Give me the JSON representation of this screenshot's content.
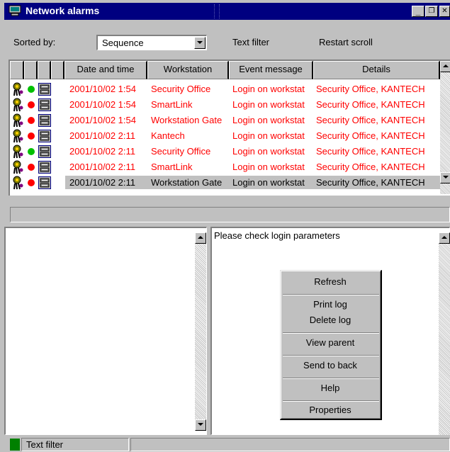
{
  "window": {
    "title": "Network alarms",
    "minimize_label": "_",
    "restore_label": "❐",
    "close_label": "✕"
  },
  "toolbar": {
    "sorted_by_label": "Sorted by:",
    "sort_value": "Sequence",
    "text_filter_label": "Text filter",
    "restart_scroll_label": "Restart scroll"
  },
  "table": {
    "columns": [
      "Date and time",
      "Workstation",
      "Event message",
      "Details"
    ],
    "rows": [
      {
        "date": "2001/10/02 1:54",
        "workstation": "Security Office",
        "event": "Login on workstat",
        "details": "Security Office, KANTECH",
        "status": "green"
      },
      {
        "date": "2001/10/02 1:54",
        "workstation": "SmartLink",
        "event": "Login on workstat",
        "details": "Security Office, KANTECH",
        "status": "red"
      },
      {
        "date": "2001/10/02 1:54",
        "workstation": "Workstation Gate",
        "event": "Login on workstat",
        "details": "Security Office, KANTECH",
        "status": "red"
      },
      {
        "date": "2001/10/02 2:11",
        "workstation": "Kantech",
        "event": "Login on workstat",
        "details": "Security Office, KANTECH",
        "status": "red"
      },
      {
        "date": "2001/10/02 2:11",
        "workstation": "Security Office",
        "event": "Login on workstat",
        "details": "Security Office, KANTECH",
        "status": "green"
      },
      {
        "date": "2001/10/02 2:11",
        "workstation": "SmartLink",
        "event": "Login on workstat",
        "details": "Security Office, KANTECH",
        "status": "red"
      },
      {
        "date": "2001/10/02 2:11",
        "workstation": "Workstation Gate",
        "event": "Login on workstat",
        "details": "Security Office, KANTECH",
        "status": "red",
        "selected": true
      }
    ]
  },
  "detail_pane": {
    "message": "Please check login parameters"
  },
  "context_menu": {
    "items": [
      "Refresh",
      "Print log",
      "Delete log",
      "View parent",
      "Send to back",
      "Help",
      "Properties"
    ]
  },
  "status_bar": {
    "text": "Text filter"
  },
  "colors": {
    "title_bar": "#000080",
    "alarm_text": "#ff0000",
    "status_green": "#00c000",
    "status_red": "#ff0000",
    "indicator": "#008000",
    "face": "#c0c0c0"
  }
}
